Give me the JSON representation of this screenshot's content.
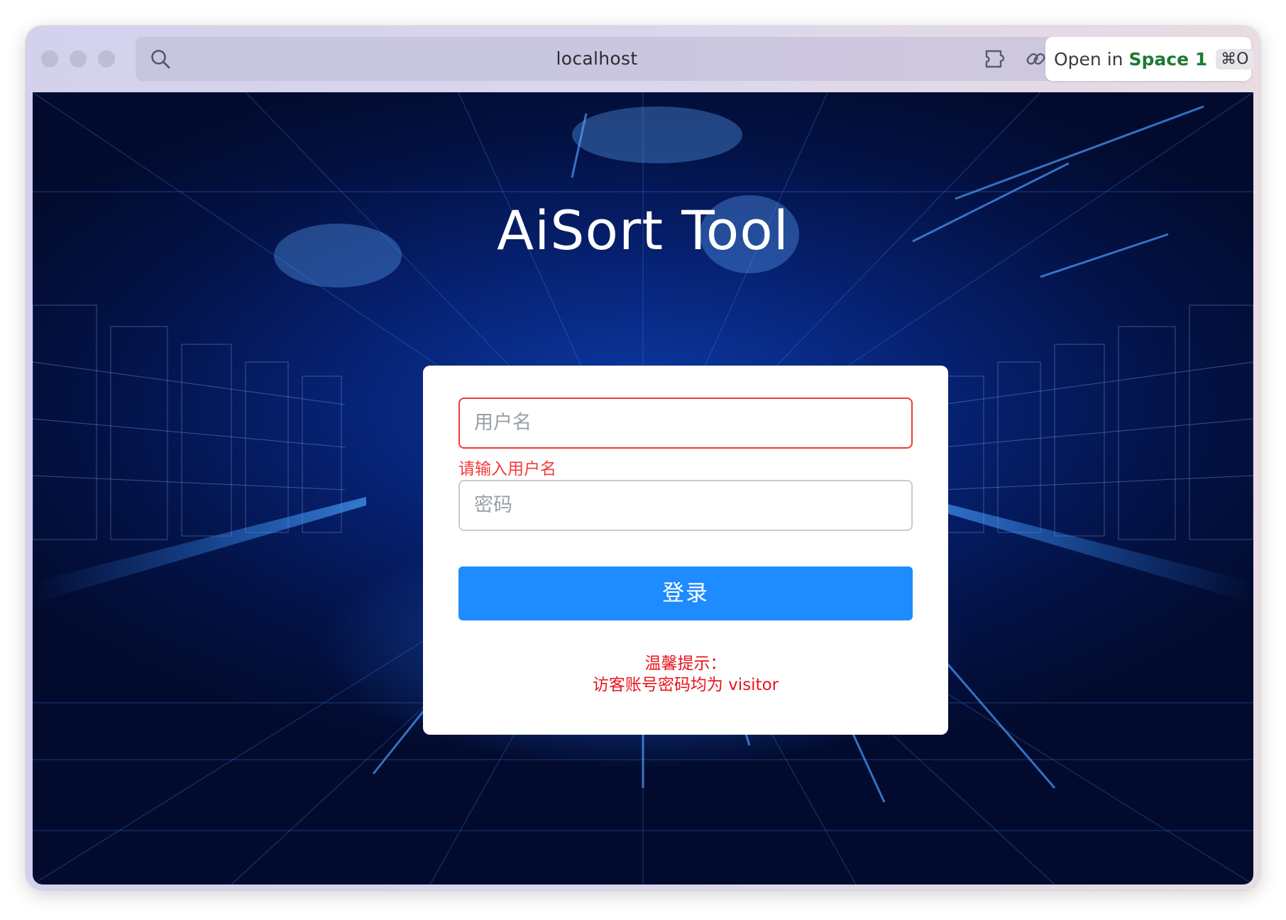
{
  "browser": {
    "url": "localhost",
    "open_in_label": "Open in",
    "space_label": "Space 1",
    "shortcut": "⌘O",
    "icons": [
      "search-icon",
      "puzzle-icon",
      "link-icon"
    ]
  },
  "page": {
    "title": "AiSort Tool",
    "login_form": {
      "username_placeholder": "用户名",
      "username_error": "请输入用户名",
      "password_placeholder": "密码",
      "submit_label": "登录",
      "hint_line1": "温馨提示：",
      "hint_line2": "访客账号密码均为 visitor"
    }
  },
  "colors": {
    "accent": "#1e8bff",
    "error": "#f13a3a",
    "hint": "#e8141c",
    "background": "#06206e"
  }
}
